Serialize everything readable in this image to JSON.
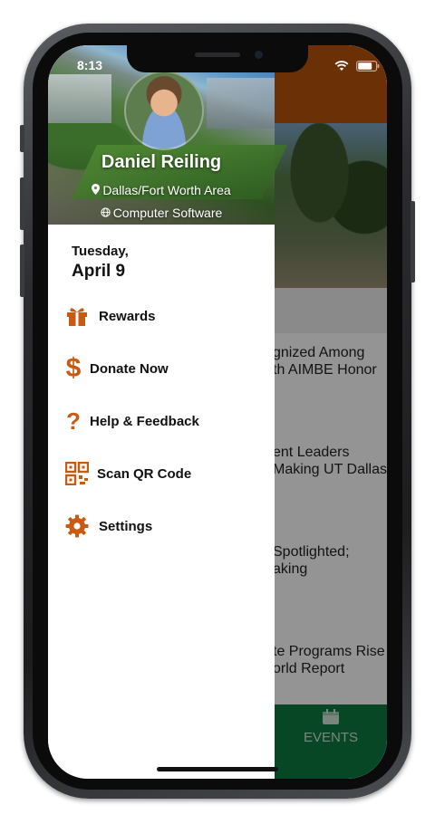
{
  "status_bar": {
    "time": "8:13"
  },
  "profile": {
    "name": "Daniel Reiling",
    "location": "Dallas/Fort Worth Area",
    "industry": "Computer Software"
  },
  "date": {
    "weekday": "Tuesday,",
    "date": "April 9"
  },
  "menu": [
    {
      "label": "Rewards",
      "icon": "gift-icon"
    },
    {
      "label": "Donate Now",
      "icon": "dollar-icon"
    },
    {
      "label": "Help & Feedback",
      "icon": "question-icon"
    },
    {
      "label": "Scan QR Code",
      "icon": "qr-code-icon"
    },
    {
      "label": "Settings",
      "icon": "gear-icon"
    }
  ],
  "background_app": {
    "news": [
      {
        "line1": "gnized Among",
        "line2": "th AIMBE Honor"
      },
      {
        "line1": "ent Leaders",
        "line2": "Making UT Dallas"
      },
      {
        "line1": "Spotlighted;",
        "line2": "aking"
      },
      {
        "line1": "te Programs Rise",
        "line2": "orld Report"
      }
    ],
    "tab_label": "EVENTS"
  },
  "colors": {
    "accent": "#c85a12",
    "header_orange": "#b8540c",
    "tab_green": "#0f7a43"
  }
}
